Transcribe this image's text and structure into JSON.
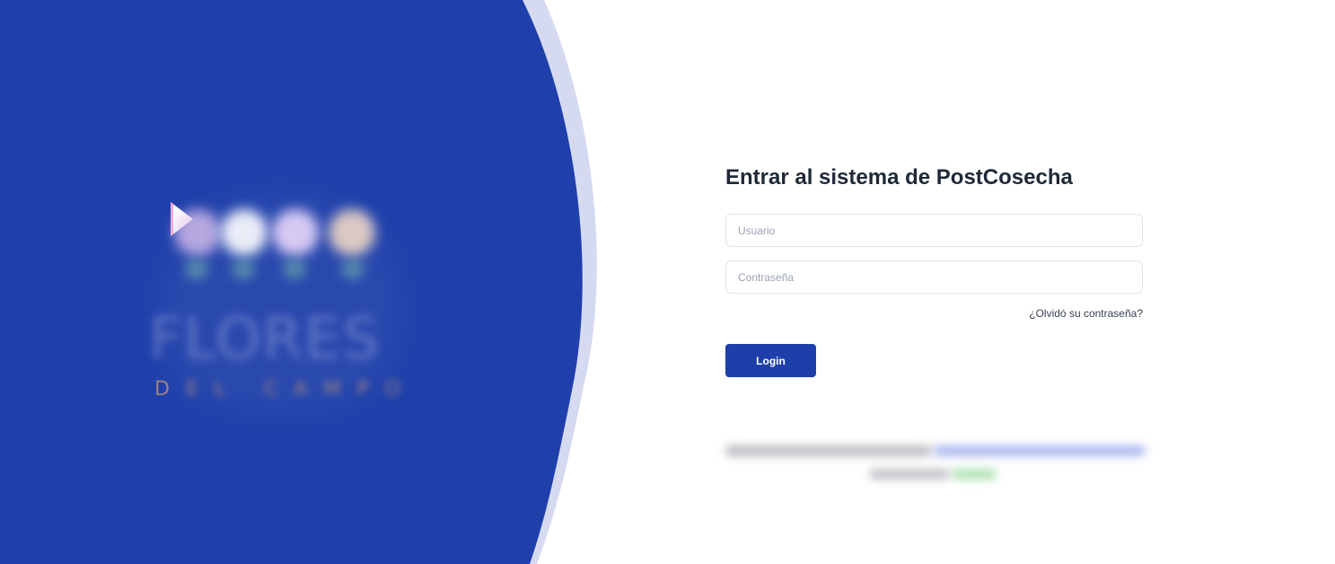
{
  "brand": {
    "logo_word": "FLORES",
    "logo_sub": "D",
    "logo_sub_blurred": "EL CAMPO",
    "colors": {
      "primary": "#1e3faa",
      "panel_blue": "#1f40ab",
      "panel_rim": "#d5daf0",
      "text_dark": "#1f2937"
    }
  },
  "login": {
    "title": "Entrar al sistema de PostCosecha",
    "username": {
      "placeholder": "Usuario",
      "value": ""
    },
    "password": {
      "placeholder": "Contraseña",
      "value": ""
    },
    "forgot_label": "¿Olvidó su contraseña?",
    "login_label": "Login"
  }
}
